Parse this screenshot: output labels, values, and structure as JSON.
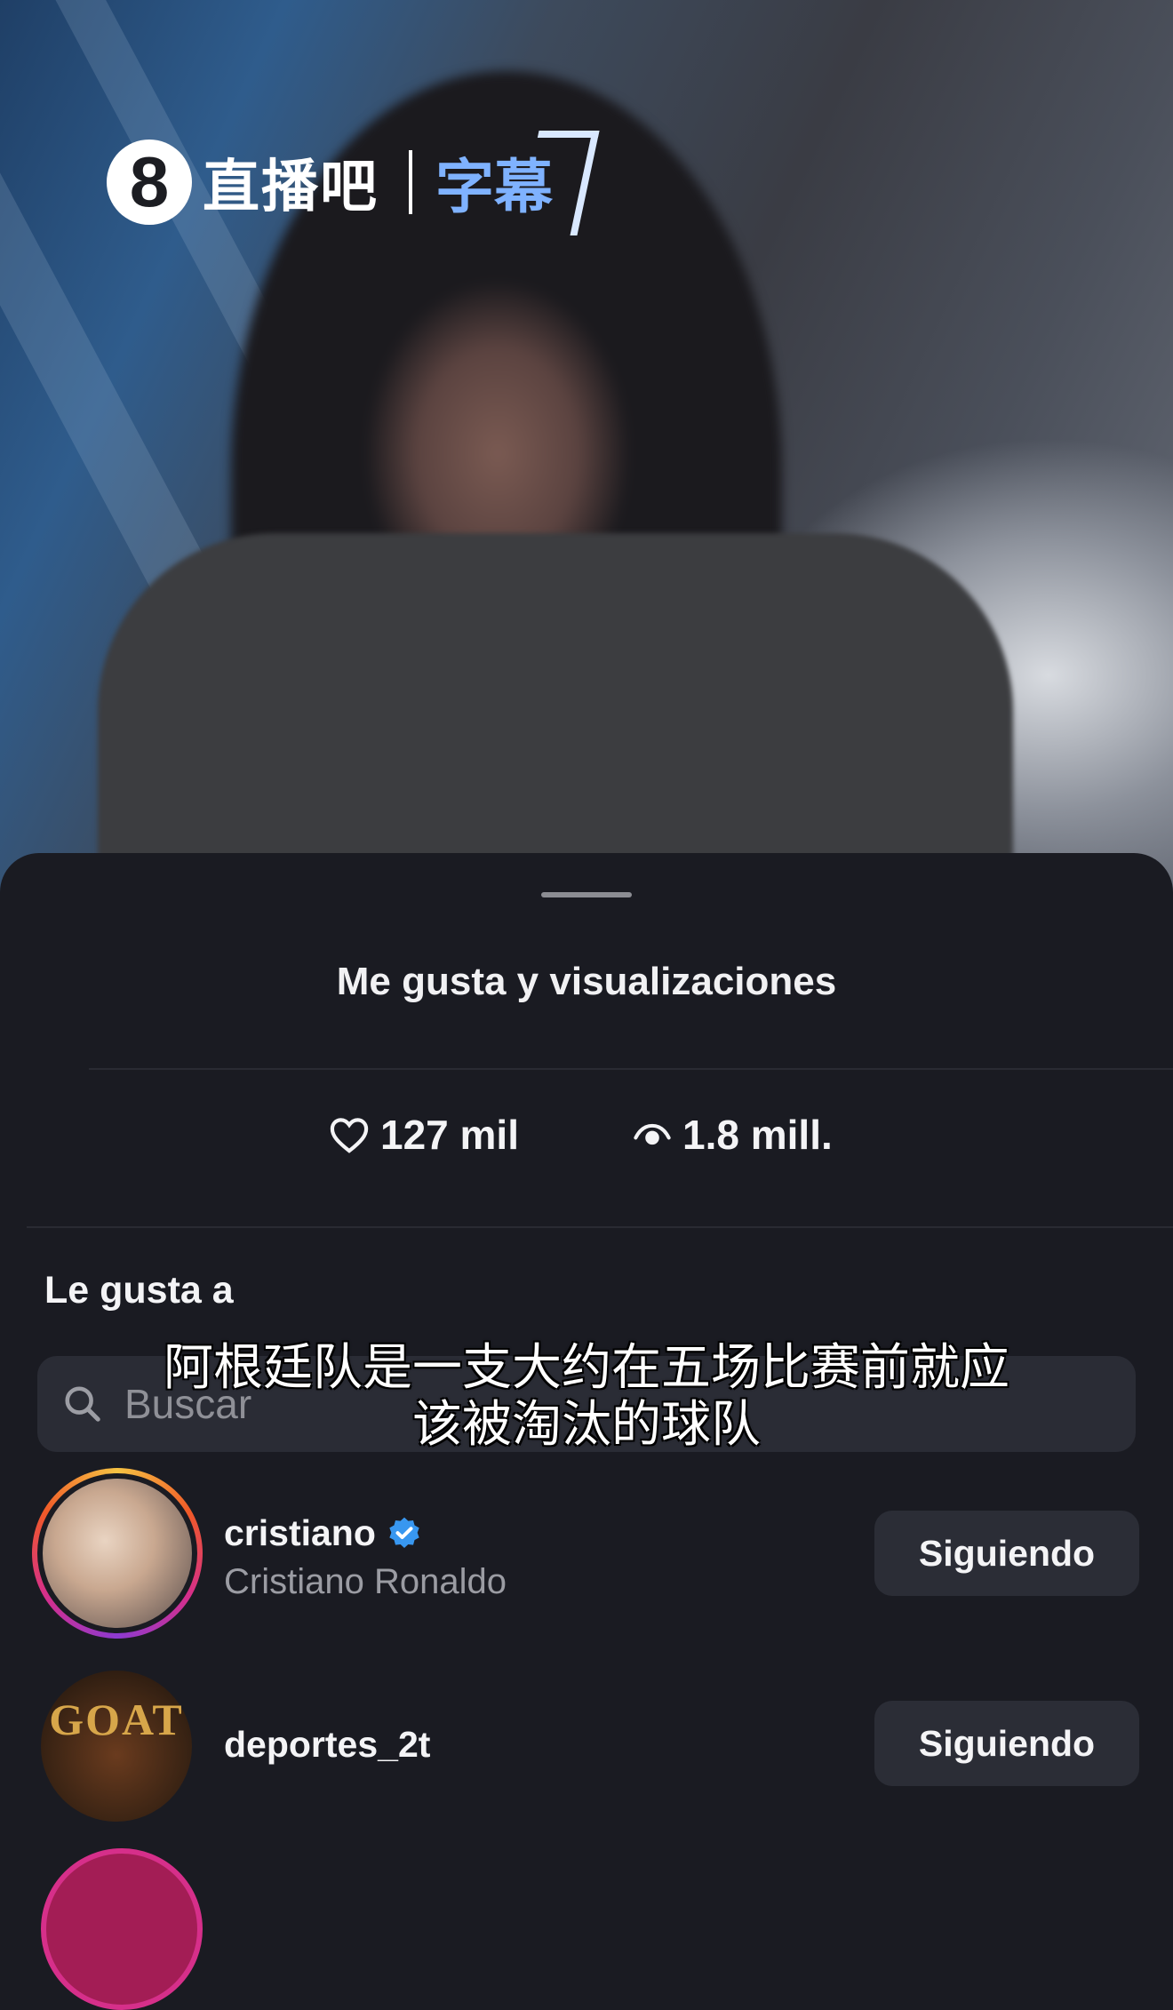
{
  "video": {
    "logo": {
      "mark": "8",
      "brand": "直播吧",
      "sub": "字幕"
    }
  },
  "sheet": {
    "title": "Me gusta y visualizaciones",
    "stats": {
      "likes": {
        "icon": "heart-icon",
        "value": "127 mil"
      },
      "views": {
        "icon": "eye-icon",
        "value": "1.8 mill."
      }
    },
    "section_label": "Le gusta a",
    "search": {
      "placeholder": "Buscar"
    },
    "users": [
      {
        "username": "cristiano",
        "verified": true,
        "fullname": "Cristiano Ronaldo",
        "button": "Siguiendo",
        "has_story_ring": true
      },
      {
        "username": "deportes_2t",
        "verified": false,
        "fullname": "",
        "avatar_text": "GOAT",
        "button": "Siguiendo",
        "has_story_ring": false
      }
    ]
  },
  "subtitle": {
    "line1": "阿根廷队是一支大约在五场比赛前就应",
    "line2": "该被淘汰的球队"
  },
  "colors": {
    "sheet_bg": "#1a1b22",
    "button_bg": "#2b2d36",
    "verified_blue": "#3897f0",
    "muted_text": "#9b9ca3"
  }
}
